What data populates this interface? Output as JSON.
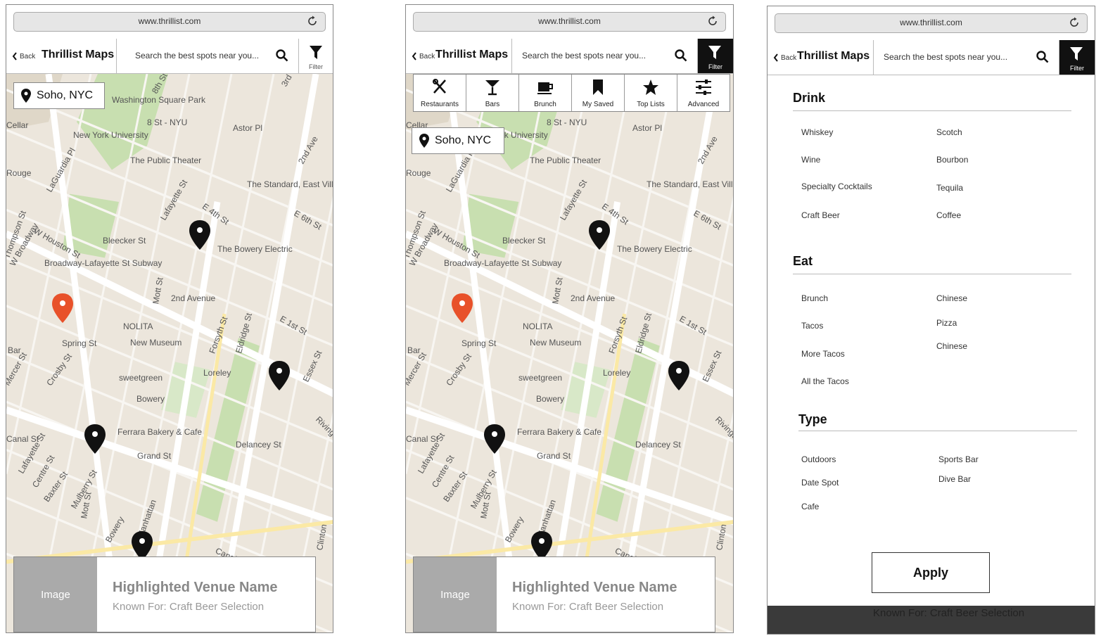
{
  "browser": {
    "url": "www.thrillist.com"
  },
  "header": {
    "back_label": "Back",
    "app_title": "Thrillist Maps",
    "search_placeholder": "Search the best spots near you...",
    "filter_label": "Filter"
  },
  "map": {
    "location_label": "Soho, NYC",
    "labels": [
      "8th St",
      "Washington Square Park",
      "8 St - NYU",
      "Astor Pl",
      "3rd",
      "Cellar",
      "New York University",
      "The Public Theater",
      "2nd Ave",
      "Rouge",
      "LaGuardia Pl",
      "Lafayette St",
      "E 4th St",
      "The Standard, East Village",
      "W Houston St",
      "E 6th St",
      "Thompson St",
      "W Broadway",
      "Bleecker St",
      "The Bowery Electric",
      "Broadway-Lafayette St Subway",
      "Mott St",
      "2nd Avenue",
      "E 1st St",
      "NOLITA",
      "New Museum",
      "Forsyth St",
      "Eldridge St",
      "Spring St",
      "Bar",
      "sweetgreen",
      "Loreley",
      "Essex St",
      "Mercer St",
      "Crosby St",
      "Bowery",
      "Rivington",
      "Ferrara Bakery & Cafe",
      "Canal St",
      "Grand St",
      "Delancey St",
      "Lafayette St",
      "Centre St",
      "Baxter St",
      "Mulberry St",
      "Mott St",
      "Bowery",
      "Manhattan",
      "Canal St",
      "Clinton"
    ]
  },
  "venue_card": {
    "image_label": "Image",
    "name": "Highlighted Venue Name",
    "known_for": "Known For: Craft Beer Selection"
  },
  "categories": [
    {
      "label": "Restaurants",
      "icon": "fork-knife-icon"
    },
    {
      "label": "Bars",
      "icon": "cocktail-glass-icon"
    },
    {
      "label": "Brunch",
      "icon": "coffee-cup-icon"
    },
    {
      "label": "My Saved",
      "icon": "bookmark-icon"
    },
    {
      "label": "Top Lists",
      "icon": "star-icon"
    },
    {
      "label": "Advanced",
      "icon": "sliders-icon"
    }
  ],
  "filter_panel": {
    "sections": [
      {
        "title": "Drink",
        "left": [
          "Whiskey",
          "Wine",
          "Specialty Cocktails",
          "Craft Beer"
        ],
        "right": [
          "Scotch",
          "Bourbon",
          "Tequila",
          "Coffee"
        ]
      },
      {
        "title": "Eat",
        "left": [
          "Brunch",
          "Tacos",
          "More Tacos",
          "All the Tacos"
        ],
        "right": [
          "Chinese",
          "Pizza",
          "Chinese"
        ]
      },
      {
        "title": "Type",
        "left": [
          "Outdoors",
          "Date Spot",
          "Cafe"
        ],
        "right": [
          "Sports Bar",
          "Dive Bar"
        ]
      }
    ],
    "apply_label": "Apply"
  },
  "colors": {
    "accent_pin": "#e8512a",
    "pin": "#111111",
    "map_bg": "#ece6dc",
    "transit": "#1f8fd6"
  }
}
